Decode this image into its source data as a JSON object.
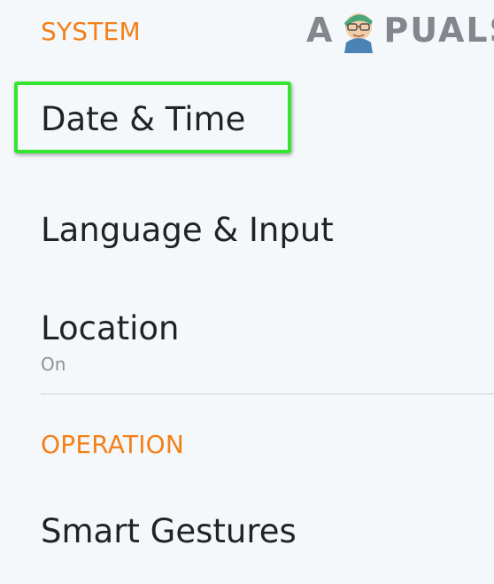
{
  "logo": {
    "text_left": "A",
    "text_right": "PUALS"
  },
  "sections": {
    "system": {
      "header": "SYSTEM",
      "items": {
        "date_time": {
          "title": "Date & Time"
        },
        "language_input": {
          "title": "Language & Input"
        },
        "location": {
          "title": "Location",
          "subtitle": "On"
        }
      }
    },
    "operation": {
      "header": "OPERATION",
      "items": {
        "smart_gestures": {
          "title": "Smart Gestures"
        }
      }
    }
  },
  "colors": {
    "section_header": "#f57f17",
    "highlight": "#33e52f",
    "title_text": "#1f2326",
    "subtitle_text": "#8c9398",
    "background": "#f4f8fb"
  }
}
